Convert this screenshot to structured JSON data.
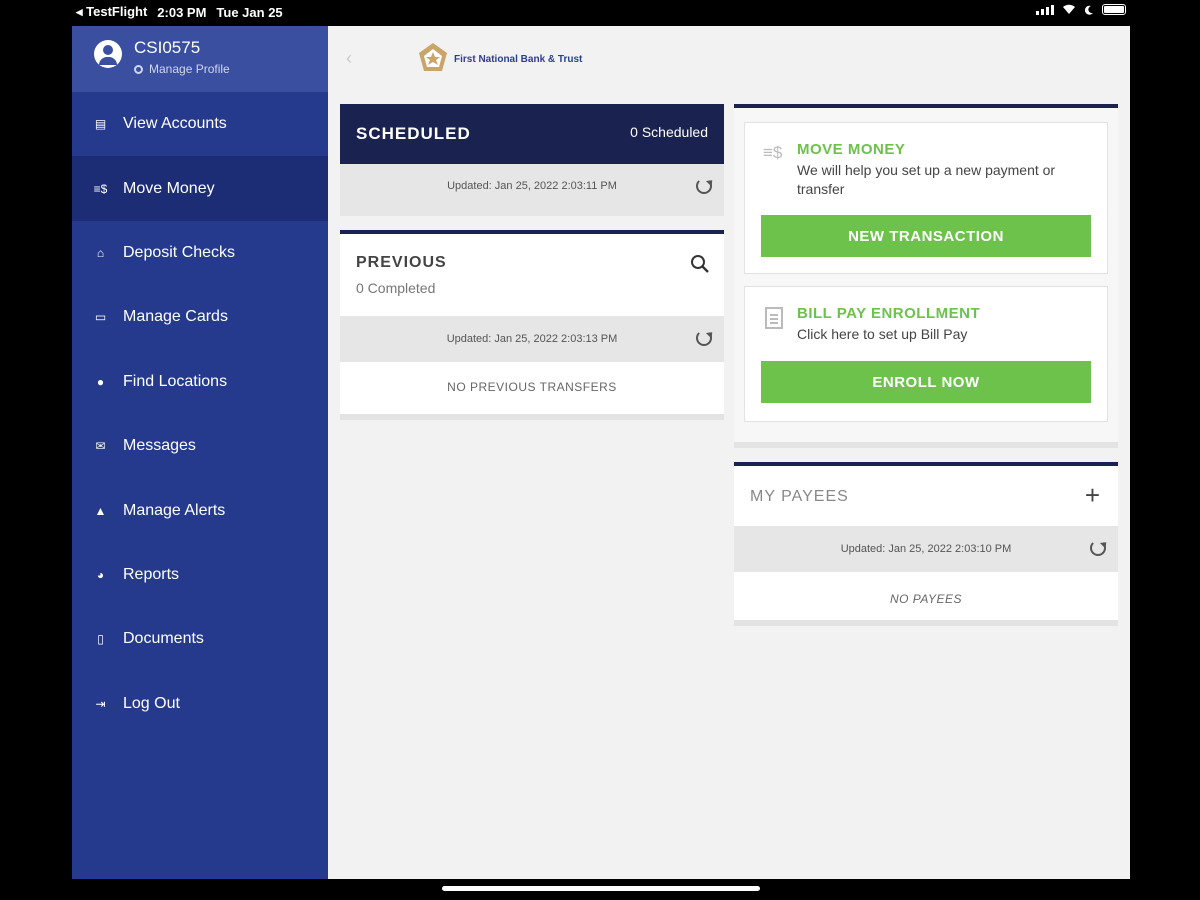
{
  "status_bar": {
    "app": "◂ TestFlight",
    "time": "2:03 PM",
    "date": "Tue Jan 25"
  },
  "profile": {
    "username": "CSI0575",
    "manage_label": "Manage Profile"
  },
  "sidebar": {
    "items": [
      {
        "label": "View Accounts",
        "icon": "accounts-icon",
        "active": false
      },
      {
        "label": "Move Money",
        "icon": "move-money-icon",
        "active": true
      },
      {
        "label": "Deposit Checks",
        "icon": "bank-icon",
        "active": false
      },
      {
        "label": "Manage Cards",
        "icon": "card-icon",
        "active": false
      },
      {
        "label": "Find Locations",
        "icon": "location-pin-icon",
        "active": false
      },
      {
        "label": "Messages",
        "icon": "envelope-icon",
        "active": false
      },
      {
        "label": "Manage Alerts",
        "icon": "bell-icon",
        "active": false
      },
      {
        "label": "Reports",
        "icon": "pie-chart-icon",
        "active": false
      },
      {
        "label": "Documents",
        "icon": "document-icon",
        "active": false
      },
      {
        "label": "Log Out",
        "icon": "logout-icon",
        "active": false
      }
    ]
  },
  "header": {
    "bank_name": "First National Bank & Trust"
  },
  "scheduled": {
    "title": "SCHEDULED",
    "count": "0 Scheduled",
    "updated": "Updated: Jan 25, 2022 2:03:11 PM"
  },
  "previous": {
    "title": "PREVIOUS",
    "completed": "0 Completed",
    "updated": "Updated: Jan 25, 2022 2:03:13 PM",
    "empty": "NO PREVIOUS TRANSFERS"
  },
  "move_money": {
    "title": "MOVE MONEY",
    "description": "We will help you set up a new payment or transfer",
    "button": "NEW TRANSACTION"
  },
  "bill_pay": {
    "title": "BILL PAY ENROLLMENT",
    "description": "Click here to set up Bill Pay",
    "button": "ENROLL NOW"
  },
  "payees": {
    "title": "MY PAYEES",
    "updated": "Updated: Jan 25, 2022 2:03:10 PM",
    "empty": "NO PAYEES"
  },
  "colors": {
    "sidebar": "#253a8c",
    "sidebar_active": "#1c2d75",
    "navy": "#1a2350",
    "green": "#6cc24a"
  }
}
